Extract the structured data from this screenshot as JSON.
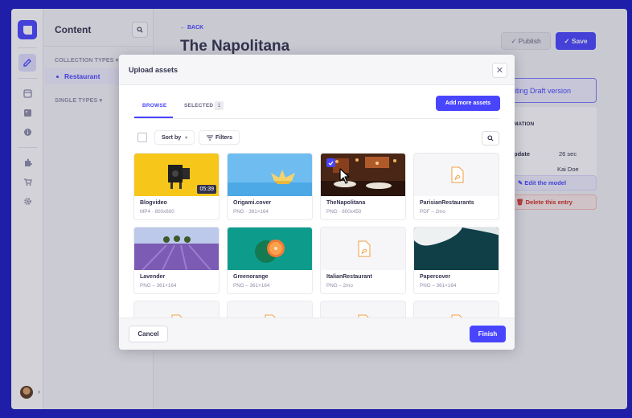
{
  "sidebar": {
    "title": "Content",
    "collection_types_label": "COLLECTION TYPES",
    "single_types_label": "SINGLE TYPES",
    "active_item": "Restaurant"
  },
  "header": {
    "back_label": "BACK",
    "title": "The Napolitana",
    "publish_label": "Publish",
    "save_label": "Save"
  },
  "right_panel": {
    "draft_text": "iting Draft version",
    "info_label": "MATION",
    "update_label": "pdate",
    "update_value": "26 sec",
    "author": "Kai Doe",
    "edit_model_label": "Edit the model",
    "delete_label": "Delete this entry"
  },
  "modal": {
    "title": "Upload assets",
    "close_icon": "close-icon",
    "tabs": [
      {
        "label": "BROWSE",
        "active": true
      },
      {
        "label": "SELECTED",
        "count": "1"
      }
    ],
    "add_more_label": "Add more assets",
    "sort_label": "Sort by",
    "filters_label": "Filters",
    "assets": [
      {
        "name": "Blogvideo",
        "meta": "MP4 · 800x600",
        "duration": "05:39",
        "selected": false
      },
      {
        "name": "Origami.cover",
        "meta": "PNG · 361×164",
        "selected": false
      },
      {
        "name": "TheNapolitana",
        "meta": "PNG · 800x450",
        "selected": true
      },
      {
        "name": "ParisianRestaurants",
        "meta": "PDF – 2mo",
        "selected": false
      },
      {
        "name": "Lavender",
        "meta": "PNG – 361×164",
        "selected": false
      },
      {
        "name": "Greenorange",
        "meta": "PNG – 361×164",
        "selected": false
      },
      {
        "name": "ItalianRestaurant",
        "meta": "PNG – 2mo",
        "selected": false
      },
      {
        "name": "Papercover",
        "meta": "PNG – 361×164",
        "selected": false
      }
    ],
    "cancel_label": "Cancel",
    "finish_label": "Finish"
  },
  "colors": {
    "primary": "#4945ff",
    "danger": "#d02b20",
    "background": "#1e1ea8"
  }
}
